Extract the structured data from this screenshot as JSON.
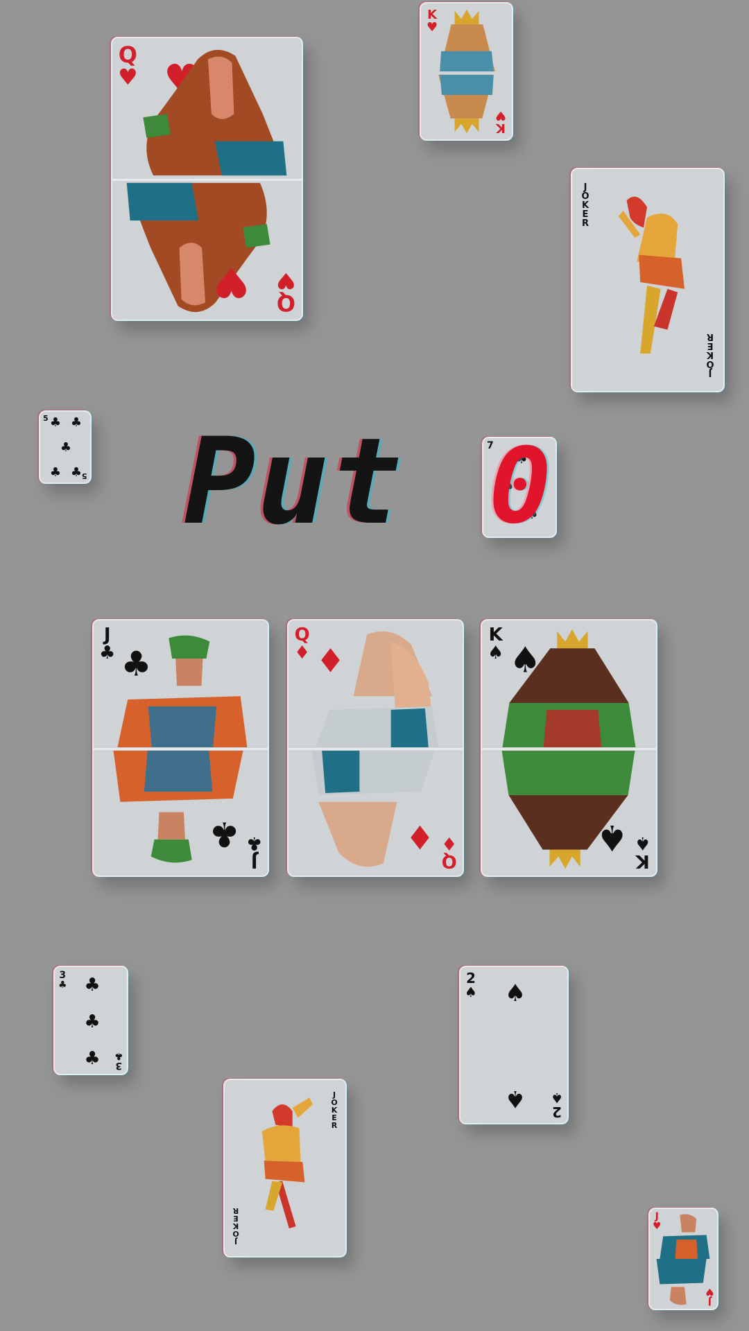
{
  "title": {
    "main": "Put",
    "last_letter": "0"
  },
  "colors": {
    "background": "#959595",
    "card": "#cfd3d6",
    "red": "#d2202a",
    "black": "#111111"
  },
  "cards": {
    "queen_hearts": {
      "rank": "Q",
      "suit": "♥"
    },
    "king_hearts": {
      "rank": "K",
      "suit": "♥"
    },
    "joker_right": {
      "rank": "JOKER"
    },
    "five_clubs": {
      "rank": "5",
      "suit": "♣"
    },
    "title_card": {
      "rank": "7",
      "suit": "♠"
    },
    "jack_clubs": {
      "rank": "J",
      "suit": "♣"
    },
    "queen_diamonds": {
      "rank": "Q",
      "suit": "♦"
    },
    "king_spades": {
      "rank": "K",
      "suit": "♠"
    },
    "three_clubs": {
      "rank": "3",
      "suit": "♣"
    },
    "two_spades": {
      "rank": "2",
      "suit": "♠"
    },
    "joker_bottom": {
      "rank": "JOKER"
    },
    "jack_hearts": {
      "rank": "J",
      "suit": "♥"
    }
  }
}
